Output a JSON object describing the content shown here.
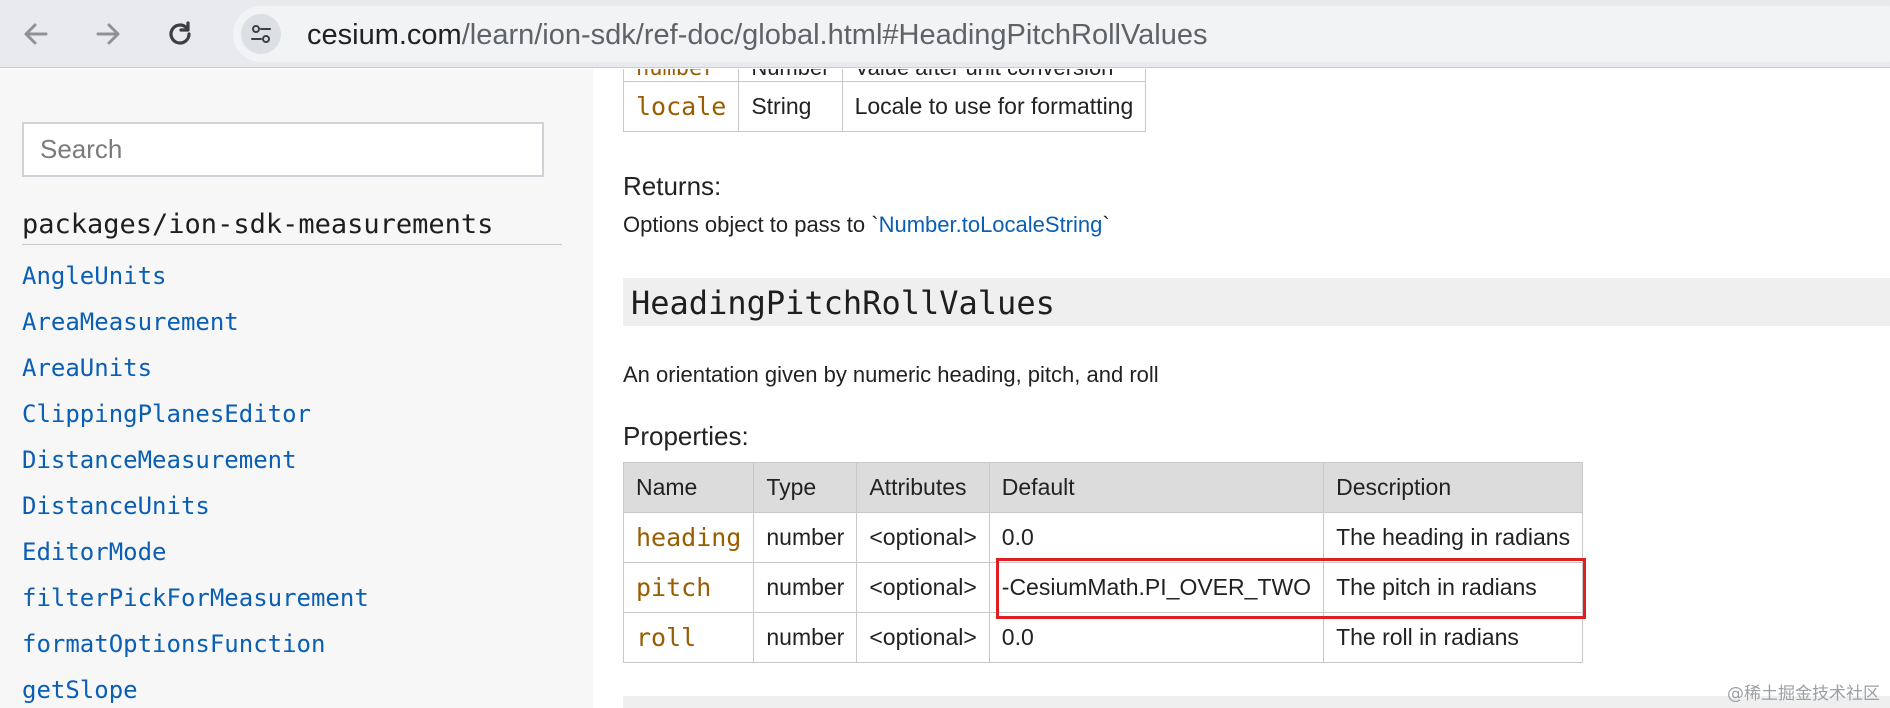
{
  "browser": {
    "url_host": "cesium.com",
    "url_path": "/learn/ion-sdk/ref-doc/global.html#HeadingPitchRollValues",
    "icons": [
      "back-arrow-icon",
      "forward-arrow-icon",
      "reload-icon",
      "site-settings-icon"
    ]
  },
  "sidebar": {
    "search_placeholder": "Search",
    "package_title": "packages/ion-sdk-measurements",
    "items": [
      "AngleUnits",
      "AreaMeasurement",
      "AreaUnits",
      "ClippingPlanesEditor",
      "DistanceMeasurement",
      "DistanceUnits",
      "EditorMode",
      "filterPickForMeasurement",
      "formatOptionsFunction",
      "getSlope"
    ]
  },
  "content": {
    "top_table": {
      "rows": [
        {
          "name": "number",
          "type": "Number",
          "description": "Value after unit conversion"
        },
        {
          "name": "locale",
          "type": "String",
          "description": "Locale to use for formatting"
        }
      ]
    },
    "returns_heading": "Returns:",
    "returns_text": "Options object to pass to `",
    "returns_link": "Number.toLocaleString",
    "returns_text_end": "`",
    "section_title": "HeadingPitchRollValues",
    "description": "An orientation given by numeric heading, pitch, and roll",
    "properties_heading": "Properties:",
    "properties_table": {
      "headers": [
        "Name",
        "Type",
        "Attributes",
        "Default",
        "Description"
      ],
      "rows": [
        {
          "name": "heading",
          "type": "number",
          "attributes": "<optional>",
          "default": "0.0",
          "description": "The heading in radians"
        },
        {
          "name": "pitch",
          "type": "number",
          "attributes": "<optional>",
          "default": "-CesiumMath.PI_OVER_TWO",
          "description": "The pitch in radians"
        },
        {
          "name": "roll",
          "type": "number",
          "attributes": "<optional>",
          "default": "0.0",
          "description": "The roll in radians"
        }
      ]
    },
    "highlight_color": "#dd1f24"
  },
  "watermark": "@稀土掘金技术社区"
}
